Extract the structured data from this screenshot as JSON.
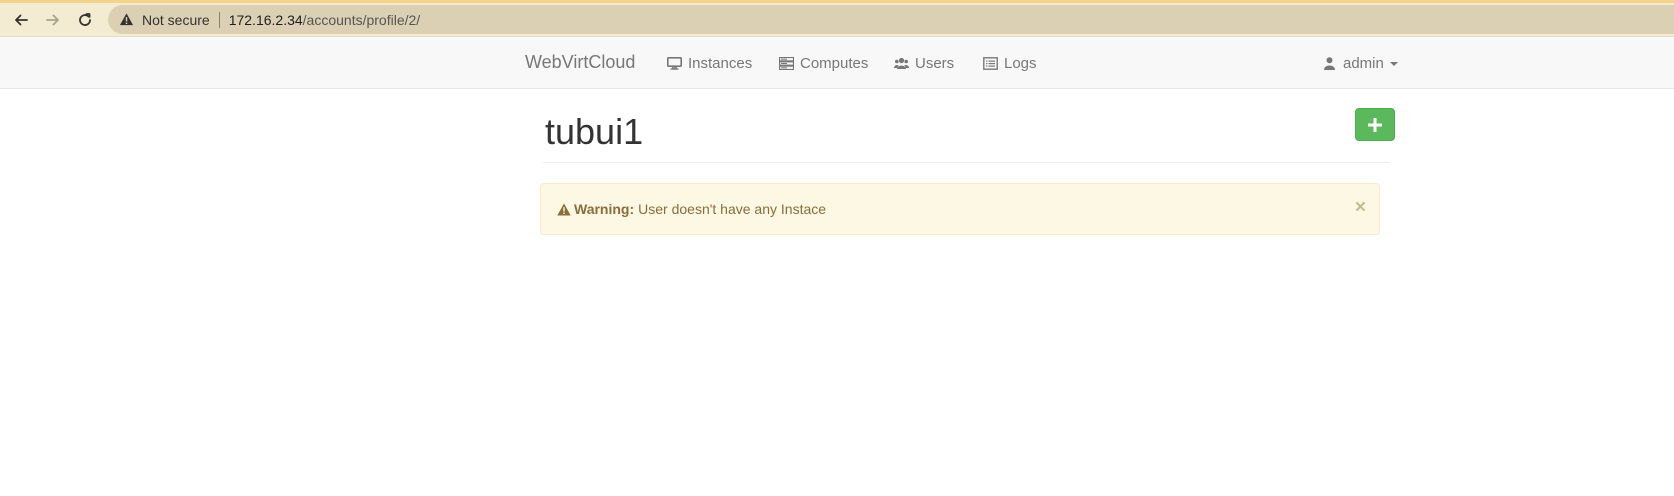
{
  "browser": {
    "security_label": "Not secure",
    "url_host": "172.16.2.34",
    "url_path": "/accounts/profile/2/"
  },
  "navbar": {
    "brand": "WebVirtCloud",
    "items": [
      {
        "label": "Instances",
        "icon": "monitor-icon"
      },
      {
        "label": "Computes",
        "icon": "server-icon"
      },
      {
        "label": "Users",
        "icon": "users-icon"
      },
      {
        "label": "Logs",
        "icon": "list-icon"
      }
    ],
    "user": {
      "label": "admin",
      "icon": "user-icon"
    }
  },
  "page": {
    "title": "tubui1",
    "add_button_icon": "plus-icon"
  },
  "alert": {
    "strong": "Warning:",
    "message": "User doesn't have any Instace",
    "close_symbol": "×"
  },
  "colors": {
    "success": "#5cb85c",
    "warning_bg": "#fcf8e3",
    "warning_text": "#8a6d3b"
  }
}
